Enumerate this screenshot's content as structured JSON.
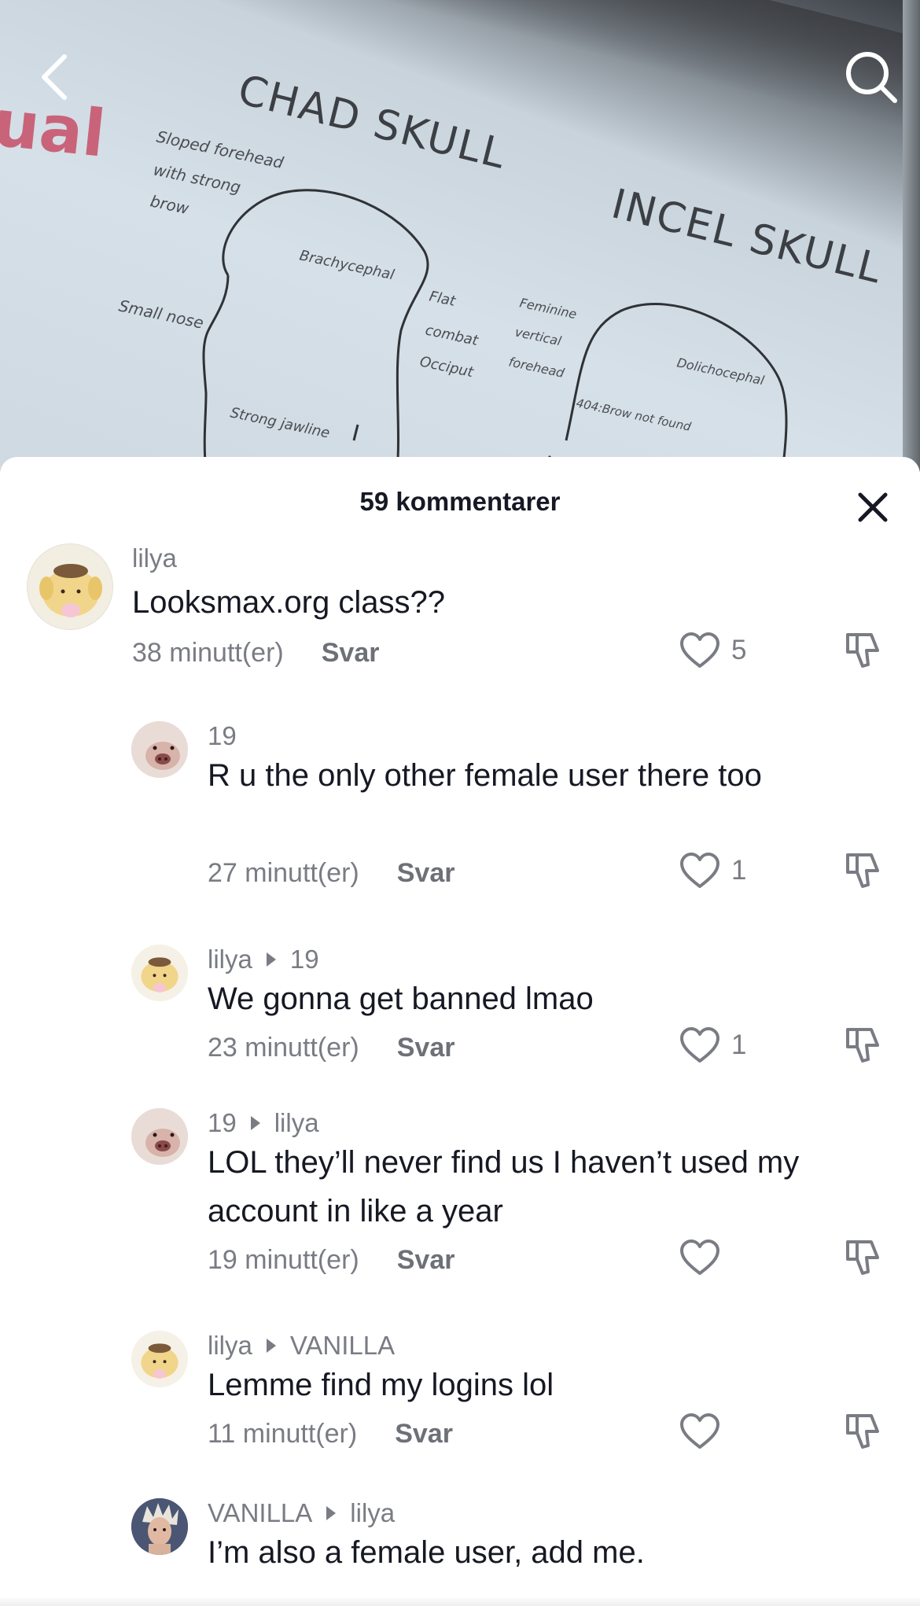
{
  "header": {
    "title": "59 kommentarer"
  },
  "background_slide": {
    "partial_word": "ual",
    "left_title": "CHAD SKULL",
    "right_title": "INCEL SKULL",
    "annotations": [
      "Sloped forehead",
      "with strong",
      "brow",
      "Brachycephal",
      "Small nose",
      "Flat",
      "combat",
      "Occiput",
      "Strong jawline",
      "Feminine",
      "vertical",
      "forehead",
      "Dolichocephal",
      "404:Brow not found"
    ]
  },
  "comments": [
    {
      "user": "lilya",
      "reply_to": "",
      "text": "Looksmax.org class??",
      "time": "38 minutt(er)",
      "reply_label": "Svar",
      "likes": "5",
      "avatar": "pompompurin-avatar"
    },
    {
      "user": "19",
      "reply_to": "",
      "text": "R u the only other female user there too",
      "time": "27 minutt(er)",
      "reply_label": "Svar",
      "likes": "1",
      "avatar": "pig-avatar"
    },
    {
      "user": "lilya",
      "reply_to": "19",
      "text": "We gonna get banned lmao",
      "time": "23 minutt(er)",
      "reply_label": "Svar",
      "likes": "1",
      "avatar": "pompompurin-avatar"
    },
    {
      "user": "19",
      "reply_to": "lilya",
      "text": "LOL they’ll never find us I haven’t used my account in like a year",
      "time": "19 minutt(er)",
      "reply_label": "Svar",
      "likes": "",
      "avatar": "pig-avatar"
    },
    {
      "user": "lilya",
      "reply_to": "VANILLA",
      "text": "Lemme find my logins lol",
      "time": "11 minutt(er)",
      "reply_label": "Svar",
      "likes": "",
      "avatar": "pompompurin-avatar"
    },
    {
      "user": "VANILLA",
      "reply_to": "lilya",
      "text": "I’m also a female user, add me.",
      "time": "",
      "reply_label": "",
      "likes": "",
      "avatar": "person-avatar"
    }
  ],
  "colors": {
    "accent_text": "#161823",
    "muted_text": "#7a7c84",
    "slide_pink": "#c9637a"
  }
}
